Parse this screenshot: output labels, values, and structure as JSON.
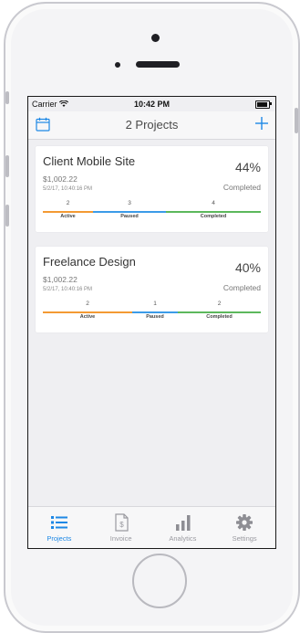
{
  "status": {
    "carrier": "Carrier",
    "time": "10:42 PM"
  },
  "nav": {
    "title": "2 Projects",
    "left_icon": "calendar-icon",
    "right_icon": "plus-icon"
  },
  "colors": {
    "accent": "#1e88e5",
    "active": "#f39a33",
    "paused": "#3b9be8",
    "completed": "#5cb85c"
  },
  "projects": [
    {
      "name": "Client Mobile Site",
      "amount": "$1,002.22",
      "date": "5/2/17, 10:40:16 PM",
      "percent": "44%",
      "percent_label": "Completed",
      "stats": [
        {
          "count": "2",
          "label": "Active"
        },
        {
          "count": "3",
          "label": "Paused"
        },
        {
          "count": "4",
          "label": "Completed"
        }
      ]
    },
    {
      "name": "Freelance Design",
      "amount": "$1,002.22",
      "date": "5/2/17, 10:40:16 PM",
      "percent": "40%",
      "percent_label": "Completed",
      "stats": [
        {
          "count": "2",
          "label": "Active"
        },
        {
          "count": "1",
          "label": "Paused"
        },
        {
          "count": "2",
          "label": "Completed"
        }
      ]
    }
  ],
  "tabs": [
    {
      "label": "Projects",
      "icon": "list-icon",
      "active": true
    },
    {
      "label": "Invoice",
      "icon": "invoice-icon",
      "active": false
    },
    {
      "label": "Analytics",
      "icon": "bar-chart-icon",
      "active": false
    },
    {
      "label": "Settings",
      "icon": "gear-icon",
      "active": false
    }
  ]
}
